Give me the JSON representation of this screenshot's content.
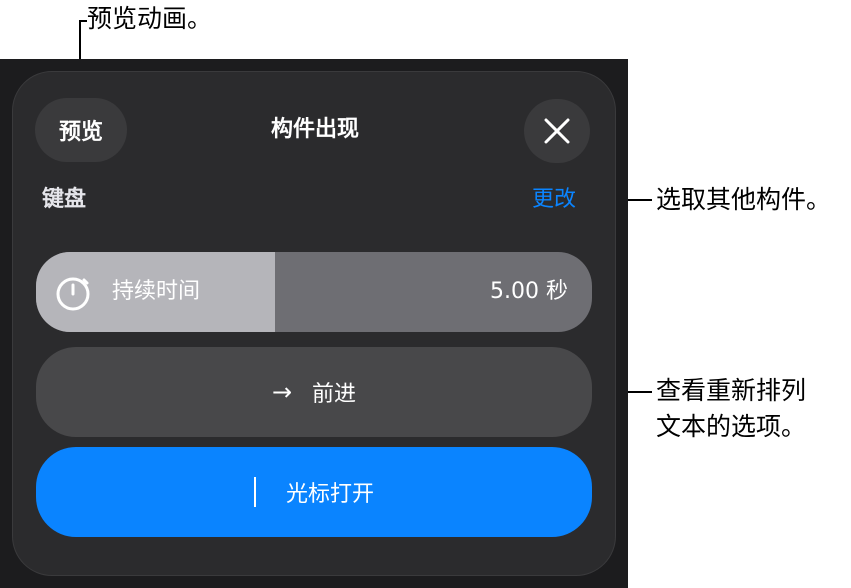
{
  "callouts": {
    "preview": "预览动画。",
    "change": "选取其他构件。",
    "options_line1": "查看重新排列",
    "options_line2": "文本的选项。"
  },
  "panel": {
    "preview_label": "预览",
    "title": "构件出现",
    "close_icon": "close-icon",
    "section_label": "键盘",
    "change_label": "更改",
    "duration": {
      "icon": "stopwatch-icon",
      "label": "持续时间",
      "value": "5.00 秒",
      "fill_fraction": 0.43
    },
    "direction": {
      "icon": "arrow-right-icon",
      "label": "前进"
    },
    "cursor": {
      "icon": "cursor-icon",
      "label": "光标打开"
    }
  },
  "colors": {
    "accent": "#0a84ff",
    "panel_bg": "#2b2b2d"
  }
}
